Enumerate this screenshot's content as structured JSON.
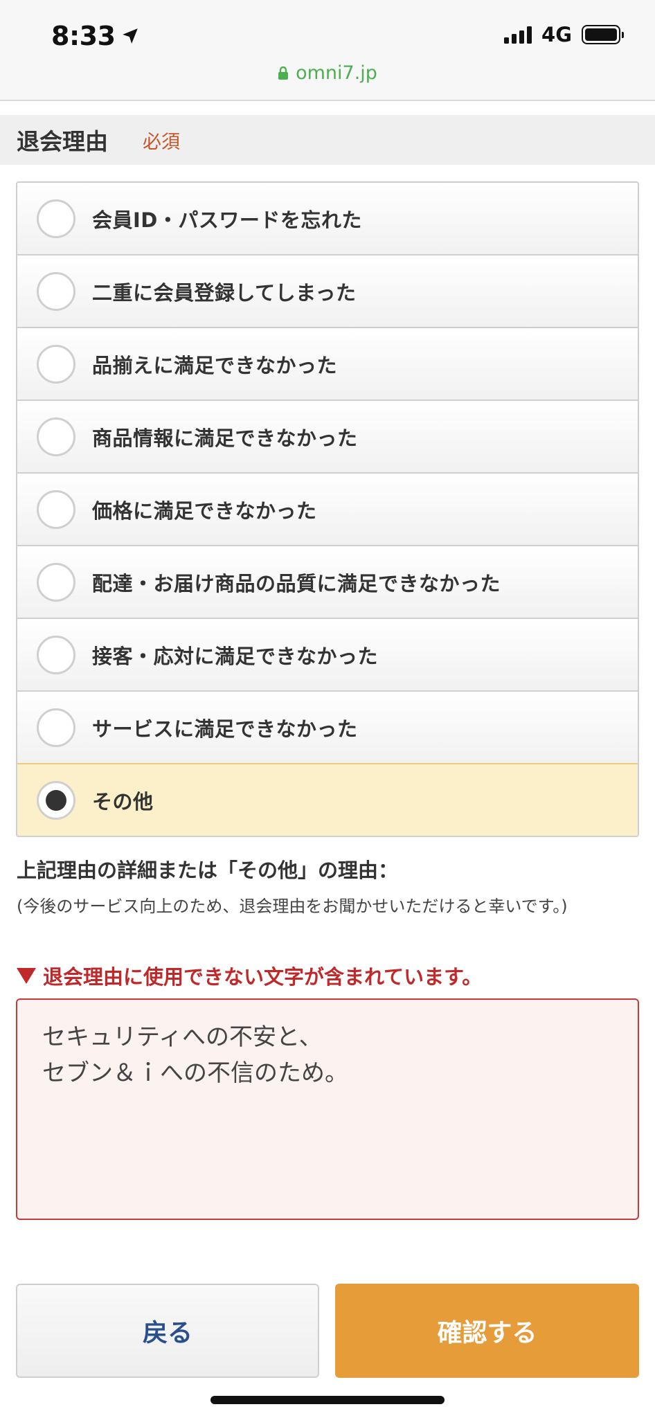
{
  "status_bar": {
    "time": "8:33",
    "network": "4G"
  },
  "url_bar": {
    "domain": "omni7.jp"
  },
  "section": {
    "title": "退会理由",
    "required": "必須"
  },
  "options": [
    {
      "label": "会員ID・パスワードを忘れた",
      "selected": false
    },
    {
      "label": "二重に会員登録してしまった",
      "selected": false
    },
    {
      "label": "品揃えに満足できなかった",
      "selected": false
    },
    {
      "label": "商品情報に満足できなかった",
      "selected": false
    },
    {
      "label": "価格に満足できなかった",
      "selected": false
    },
    {
      "label": "配達・お届け商品の品質に満足できなかった",
      "selected": false
    },
    {
      "label": "接客・応対に満足できなかった",
      "selected": false
    },
    {
      "label": "サービスに満足できなかった",
      "selected": false
    },
    {
      "label": "その他",
      "selected": true
    }
  ],
  "details": {
    "label": "上記理由の詳細または「その他」の理由：",
    "note": "(今後のサービス向上のため、退会理由をお聞かせいただけると幸いです。)",
    "error": "退会理由に使用できない文字が含まれています。",
    "textarea_value": "セキュリティへの不安と、\nセブン＆ｉへの不信のため。"
  },
  "buttons": {
    "back": "戻る",
    "confirm": "確認する"
  },
  "colors": {
    "accent": "#e79c3a",
    "error": "#c0282a",
    "selected_bg": "#fbf0c9",
    "url": "#4caf50"
  }
}
